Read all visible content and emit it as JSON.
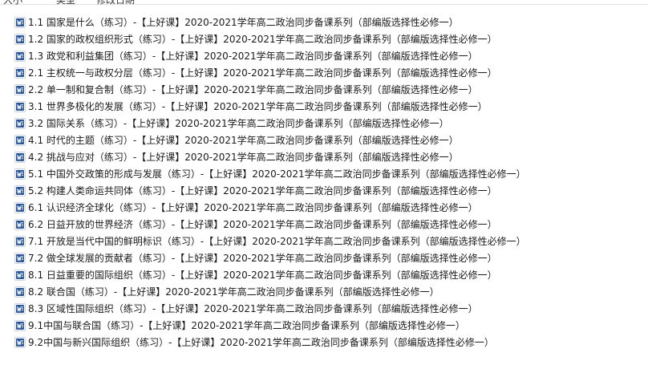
{
  "header": {
    "col_1": "大小",
    "col_2": "类型",
    "col_3": "修改日期"
  },
  "colors": {
    "word_icon_blue": "#2b5797",
    "word_icon_frame": "#c9d4e6",
    "text": "#1a1a1a"
  },
  "files": [
    {
      "icon": "word-doc-icon",
      "name": "1.1 国家是什么（练习）-【上好课】2020-2021学年高二政治同步备课系列（部编版选择性必修一）"
    },
    {
      "icon": "word-doc-icon",
      "name": "1.2 国家的政权组织形式（练习）-【上好课】2020-2021学年高二政治同步备课系列（部编版选择性必修一）"
    },
    {
      "icon": "word-doc-icon",
      "name": "1.3 政党和利益集团（练习）-【上好课】2020-2021学年高二政治同步备课系列（部编版选择性必修一）"
    },
    {
      "icon": "word-doc-icon",
      "name": "2.1 主权统一与政权分层（练习）-【上好课】2020-2021学年高二政治同步备课系列（部编版选择性必修一）"
    },
    {
      "icon": "word-doc-icon",
      "name": "2.2 单一制和复合制（练习）-【上好课】2020-2021学年高二政治同步备课系列（部编版选择性必修一）"
    },
    {
      "icon": "word-doc-icon",
      "name": "3.1 世界多极化的发展（练习）-【上好课】2020-2021学年高二政治同步备课系列（部编版选择性必修一）"
    },
    {
      "icon": "word-doc-icon",
      "name": "3.2 国际关系（练习）-【上好课】2020-2021学年高二政治同步备课系列（部编版选择性必修一）"
    },
    {
      "icon": "word-doc-icon",
      "name": "4.1 时代的主题（练习）-【上好课】2020-2021学年高二政治同步备课系列（部编版选择性必修一）"
    },
    {
      "icon": "word-doc-icon",
      "name": "4.2 挑战与应对（练习）-【上好课】2020-2021学年高二政治同步备课系列（部编版选择性必修一）"
    },
    {
      "icon": "word-doc-icon",
      "name": "5.1 中国外交政策的形成与发展（练习）-【上好课】2020-2021学年高二政治同步备课系列（部编版选择性必修一）"
    },
    {
      "icon": "word-doc-icon",
      "name": "5.2 构建人类命运共同体（练习）-【上好课】2020-2021学年高二政治同步备课系列（部编版选择性必修一）"
    },
    {
      "icon": "word-doc-icon",
      "name": "6.1 认识经济全球化（练习）-【上好课】2020-2021学年高二政治同步备课系列（部编版选择性必修一）"
    },
    {
      "icon": "word-doc-icon",
      "name": "6.2 日益开放的世界经济（练习）-【上好课】2020-2021学年高二政治同步备课系列（部编版选择性必修一）"
    },
    {
      "icon": "word-doc-icon",
      "name": "7.1 开放是当代中国的鲜明标识（练习）-【上好课】2020-2021学年高二政治同步备课系列（部编版选择性必修一）"
    },
    {
      "icon": "word-doc-icon",
      "name": "7.2 做全球发展的贡献者（练习）-【上好课】2020-2021学年高二政治同步备课系列（部编版选择性必修一）"
    },
    {
      "icon": "word-doc-icon",
      "name": "8.1 日益重要的国际组织（练习）-【上好课】2020-2021学年高二政治同步备课系列（部编版选择性必修一）"
    },
    {
      "icon": "word-doc-icon",
      "name": "8.2 联合国（练习）-【上好课】2020-2021学年高二政治同步备课系列（部编版选择性必修一）"
    },
    {
      "icon": "word-doc-icon",
      "name": "8.3 区域性国际组织（练习）-【上好课】2020-2021学年高二政治同步备课系列（部编版选择性必修一）"
    },
    {
      "icon": "word-doc-icon",
      "name": "9.1中国与联合国（练习）-【上好课】2020-2021学年高二政治同步备课系列（部编版选择性必修一）"
    },
    {
      "icon": "word-doc-icon",
      "name": "9.2中国与新兴国际组织（练习）-【上好课】2020-2021学年高二政治同步备课系列（部编版选择性必修一）"
    }
  ]
}
